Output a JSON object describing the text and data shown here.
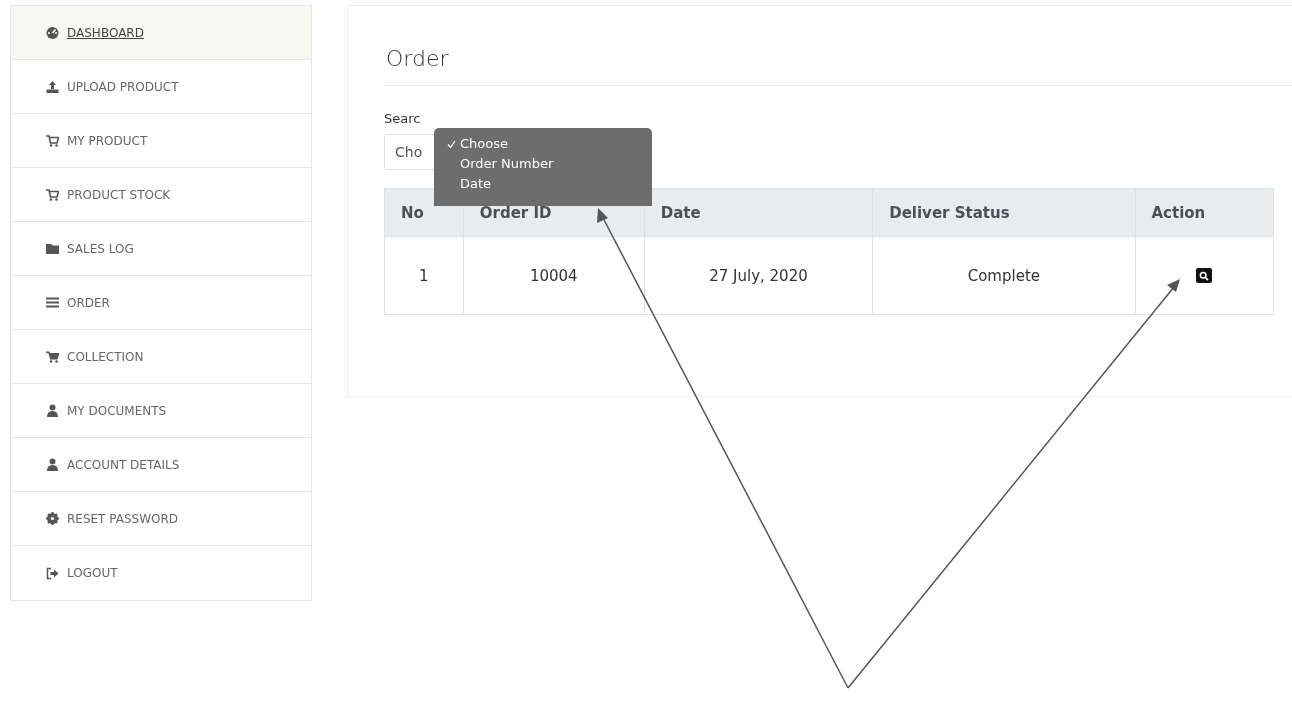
{
  "sidebar": {
    "items": [
      {
        "label": "DASHBOARD",
        "selected": true
      },
      {
        "label": "UPLOAD PRODUCT",
        "selected": false
      },
      {
        "label": "MY PRODUCT",
        "selected": false
      },
      {
        "label": "PRODUCT STOCK",
        "selected": false
      },
      {
        "label": "SALES LOG",
        "selected": false
      },
      {
        "label": "ORDER",
        "selected": false
      },
      {
        "label": "COLLECTION",
        "selected": false
      },
      {
        "label": "MY DOCUMENTS",
        "selected": false
      },
      {
        "label": "ACCOUNT DETAILS",
        "selected": false
      },
      {
        "label": "RESET PASSWORD",
        "selected": false
      },
      {
        "label": "LOGOUT",
        "selected": false
      }
    ]
  },
  "main": {
    "title": "Order",
    "search": {
      "label": "Searc",
      "value": "Cho",
      "menu": [
        {
          "label": "Choose",
          "selected": true
        },
        {
          "label": "Order Number",
          "selected": false
        },
        {
          "label": "Date",
          "selected": false
        }
      ]
    },
    "table": {
      "columns": [
        "No",
        "Order ID",
        "Date",
        "Deliver Status",
        "Action"
      ],
      "rows": [
        {
          "cells": [
            "1",
            "10004",
            "27 July, 2020",
            "Complete"
          ]
        }
      ]
    }
  }
}
